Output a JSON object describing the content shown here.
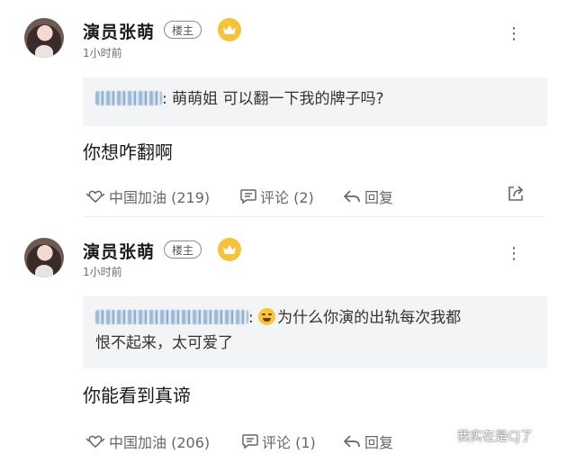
{
  "posts": [
    {
      "author": "演员张萌",
      "badge": "楼主",
      "time": "1小时前",
      "quote_prefix": ":",
      "quote_text": "萌萌姐 可以翻一下我的牌子吗?",
      "content": "你想咋翻啊",
      "actions": {
        "cheer": "中国加油 (219)",
        "comment": "评论 (2)",
        "reply": "回复"
      }
    },
    {
      "author": "演员张萌",
      "badge": "楼主",
      "time": "1小时前",
      "quote_prefix": ":",
      "quote_text_line1": "为什么你演的出轨每次我都",
      "quote_text_line2": "恨不起来，太可爱了",
      "content": "你能看到真谛",
      "actions": {
        "cheer": "中国加油 (206)",
        "comment": "评论 (1)",
        "reply": "回复"
      }
    }
  ],
  "watermark": "我实在是CJ了",
  "colors": {
    "crown": "#f5c23b",
    "quote_bg": "#f3f4f6",
    "text_secondary": "#666666"
  },
  "icons": [
    "more-vertical-icon",
    "crown-icon",
    "heart-hands-icon",
    "comment-icon",
    "reply-icon",
    "share-icon",
    "wechat-logo-icon",
    "laughing-emoji-icon"
  ]
}
